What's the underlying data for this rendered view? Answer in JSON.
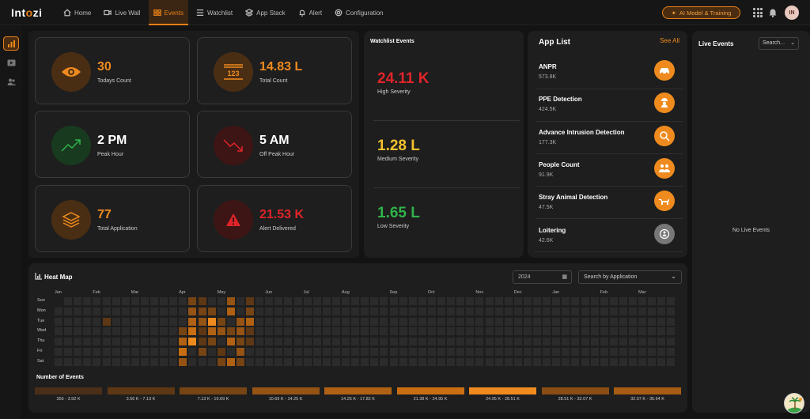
{
  "brand": {
    "logo_prefix": "Int",
    "logo_mid": "o",
    "logo_suffix": "zi"
  },
  "nav": [
    {
      "label": "Home",
      "icon": "home-icon"
    },
    {
      "label": "Live Wall",
      "icon": "video-icon"
    },
    {
      "label": "Events",
      "icon": "events-icon",
      "active": true
    },
    {
      "label": "Watchlist",
      "icon": "list-icon"
    },
    {
      "label": "App Stack",
      "icon": "stack-icon"
    },
    {
      "label": "Alert",
      "icon": "alert-icon"
    },
    {
      "label": "Configuration",
      "icon": "gear-icon"
    }
  ],
  "header": {
    "ai_button": "AI Model & Training",
    "avatar": "IN"
  },
  "stats": [
    {
      "value": "30",
      "label": "Todays Count",
      "icon": "eye-icon"
    },
    {
      "value": "14.83 L",
      "label": "Total Count",
      "icon": "counter-icon"
    },
    {
      "value": "2 PM",
      "label": "Peak Hour",
      "icon": "trend-up-icon"
    },
    {
      "value": "5 AM",
      "label": "Off Peak Hour",
      "icon": "trend-down-icon"
    },
    {
      "value": "77",
      "label": "Total Application",
      "icon": "layers-icon"
    },
    {
      "value": "21.53 K",
      "label": "Alert Delivered",
      "icon": "warning-icon"
    }
  ],
  "watchlist": {
    "title": "Watchlist Events",
    "items": [
      {
        "value": "24.11 K",
        "label": "High Severity"
      },
      {
        "value": "1.28 L",
        "label": "Medium Severity"
      },
      {
        "value": "1.65 L",
        "label": "Low Severity"
      }
    ]
  },
  "app_list": {
    "title": "App List",
    "see_all": "See All",
    "items": [
      {
        "name": "ANPR",
        "count": "573.8K",
        "icon": "car-icon"
      },
      {
        "name": "PPE Detection",
        "count": "424.5K",
        "icon": "ppe-icon"
      },
      {
        "name": "Advance Intrusion Detection",
        "count": "177.3K",
        "icon": "intrusion-icon"
      },
      {
        "name": "People Count",
        "count": "91.9K",
        "icon": "people-icon"
      },
      {
        "name": "Stray Animal Detection",
        "count": "47.5K",
        "icon": "dog-icon"
      },
      {
        "name": "Loitering",
        "count": "42.6K",
        "icon": "loitering-icon"
      }
    ]
  },
  "live_events": {
    "title": "Live Events",
    "search_placeholder": "Search...",
    "empty": "No Live Events"
  },
  "heatmap": {
    "title": "Heat Map",
    "year": "2024",
    "app_placeholder": "Search by Application",
    "months": [
      "Jan",
      "Feb",
      "Mar",
      "Apr",
      "May",
      "Jun",
      "Jul",
      "Aug",
      "Sep",
      "Oct",
      "Nov",
      "Dec",
      "Jan",
      "Feb",
      "Mar"
    ],
    "days": [
      "Sun",
      "Mon",
      "Tue",
      "Wed",
      "Thu",
      "Fri",
      "Sat"
    ],
    "legend_title": "Number of Events",
    "legend": [
      {
        "label": "356 - 3.92 K",
        "color": "#4a2e17"
      },
      {
        "label": "3.56 K - 7.13 K",
        "color": "#5e3714"
      },
      {
        "label": "7.13 K - 10.69 K",
        "color": "#774414"
      },
      {
        "label": "10.69 K - 14.25 K",
        "color": "#955314"
      },
      {
        "label": "14.25 K - 17.82 K",
        "color": "#b06113"
      },
      {
        "label": "21.38 K - 24.95 K",
        "color": "#c96e12"
      },
      {
        "label": "24.95 K - 28.51 K",
        "color": "#ef8b1e"
      },
      {
        "label": "28.51 K - 32.07 K",
        "color": "#8a4d14"
      },
      {
        "label": "32.07 K - 35.64 K",
        "color": "#a85b13"
      }
    ]
  }
}
